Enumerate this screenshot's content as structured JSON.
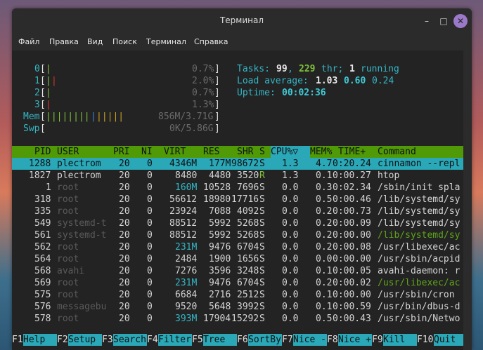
{
  "window": {
    "title": "Терминал",
    "minimize": "–",
    "maximize": "□",
    "close": "✕"
  },
  "menu": [
    "Файл",
    "Правка",
    "Вид",
    "Поиск",
    "Терминал",
    "Справка"
  ],
  "meters": {
    "cpu": [
      {
        "label": "0",
        "bar": "|",
        "pct": "0.7%"
      },
      {
        "label": "1",
        "bar": "||",
        "pct": "2.0%"
      },
      {
        "label": "2",
        "bar": "|",
        "pct": "0.7%"
      },
      {
        "label": "3",
        "bar": "|",
        "pct": "1.3%"
      }
    ],
    "mem": {
      "label": "Mem",
      "bar": "||||||||||||",
      "value": "856M/3.71G"
    },
    "swp": {
      "label": "Swp",
      "bar": "",
      "value": "0K/5.86G"
    }
  },
  "summary": {
    "tasks_label": "Tasks:",
    "tasks": "99",
    "thr": "229",
    "thr_label": "thr;",
    "running": "1",
    "running_label": "running",
    "load_label": "Load average:",
    "load1": "1.03",
    "load5": "0.60",
    "load15": "0.24",
    "uptime_label": "Uptime:",
    "uptime": "00:02:36"
  },
  "columns": [
    "PID",
    "USER",
    "PRI",
    "NI",
    "VIRT",
    "RES",
    "SHR",
    "S",
    "CPU%▽",
    "MEM%",
    "TIME+",
    "Command"
  ],
  "rows": [
    [
      "1288",
      "plectrom",
      "20",
      "0",
      "4346M",
      "177M",
      "98672",
      "S",
      "1.3",
      "4.7",
      "0:20.24",
      "cinnamon --repl"
    ],
    [
      "1827",
      "plectrom",
      "20",
      "0",
      "8480",
      "4480",
      "3520",
      "R",
      "1.3",
      "0.1",
      "0:00.27",
      "htop"
    ],
    [
      "1",
      "root",
      "20",
      "0",
      "160M",
      "10528",
      "7696",
      "S",
      "0.0",
      "0.3",
      "0:02.34",
      "/sbin/init spla"
    ],
    [
      "318",
      "root",
      "20",
      "0",
      "56612",
      "18980",
      "17716",
      "S",
      "0.0",
      "0.5",
      "0:00.46",
      "/lib/systemd/sy"
    ],
    [
      "335",
      "root",
      "20",
      "0",
      "23924",
      "7088",
      "4092",
      "S",
      "0.0",
      "0.2",
      "0:00.73",
      "/lib/systemd/sy"
    ],
    [
      "549",
      "systemd-t",
      "20",
      "0",
      "88512",
      "5992",
      "5268",
      "S",
      "0.0",
      "0.2",
      "0:00.09",
      "/lib/systemd/sy"
    ],
    [
      "561",
      "systemd-t",
      "20",
      "0",
      "88512",
      "5992",
      "5268",
      "S",
      "0.0",
      "0.2",
      "0:00.00",
      "/lib/systemd/sy"
    ],
    [
      "562",
      "root",
      "20",
      "0",
      "231M",
      "9476",
      "6704",
      "S",
      "0.0",
      "0.2",
      "0:00.08",
      "/usr/libexec/ac"
    ],
    [
      "564",
      "root",
      "20",
      "0",
      "2484",
      "1900",
      "1656",
      "S",
      "0.0",
      "0.0",
      "0:00.00",
      "/usr/sbin/acpid"
    ],
    [
      "568",
      "avahi",
      "20",
      "0",
      "7276",
      "3596",
      "3248",
      "S",
      "0.0",
      "0.1",
      "0:00.05",
      "avahi-daemon: r"
    ],
    [
      "569",
      "root",
      "20",
      "0",
      "231M",
      "9476",
      "6704",
      "S",
      "0.0",
      "0.2",
      "0:00.02",
      "/usr/libexec/ac"
    ],
    [
      "575",
      "root",
      "20",
      "0",
      "6684",
      "2716",
      "2512",
      "S",
      "0.0",
      "0.1",
      "0:00.00",
      "/usr/sbin/cron"
    ],
    [
      "576",
      "messagebu",
      "20",
      "0",
      "9520",
      "5648",
      "3992",
      "S",
      "0.0",
      "0.1",
      "0:00.59",
      "/usr/bin/dbus-d"
    ],
    [
      "578",
      "root",
      "20",
      "0",
      "393M",
      "17904",
      "15292",
      "S",
      "0.0",
      "0.5",
      "0:00.43",
      "/usr/sbin/Netwo"
    ]
  ],
  "footer": [
    {
      "key": "F1",
      "label": "Help"
    },
    {
      "key": "F2",
      "label": "Setup"
    },
    {
      "key": "F3",
      "label": "Search"
    },
    {
      "key": "F4",
      "label": "Filter"
    },
    {
      "key": "F5",
      "label": "Tree"
    },
    {
      "key": "F6",
      "label": "SortBy"
    },
    {
      "key": "F7",
      "label": "Nice -"
    },
    {
      "key": "F8",
      "label": "Nice +"
    },
    {
      "key": "F9",
      "label": "Kill"
    },
    {
      "key": "F10",
      "label": "Quit"
    }
  ],
  "colors": {
    "header_bg": "#4f9a06",
    "selected_bg": "#2aa8b8",
    "accent": "#34b7c6",
    "threads": "#7ec23a"
  }
}
